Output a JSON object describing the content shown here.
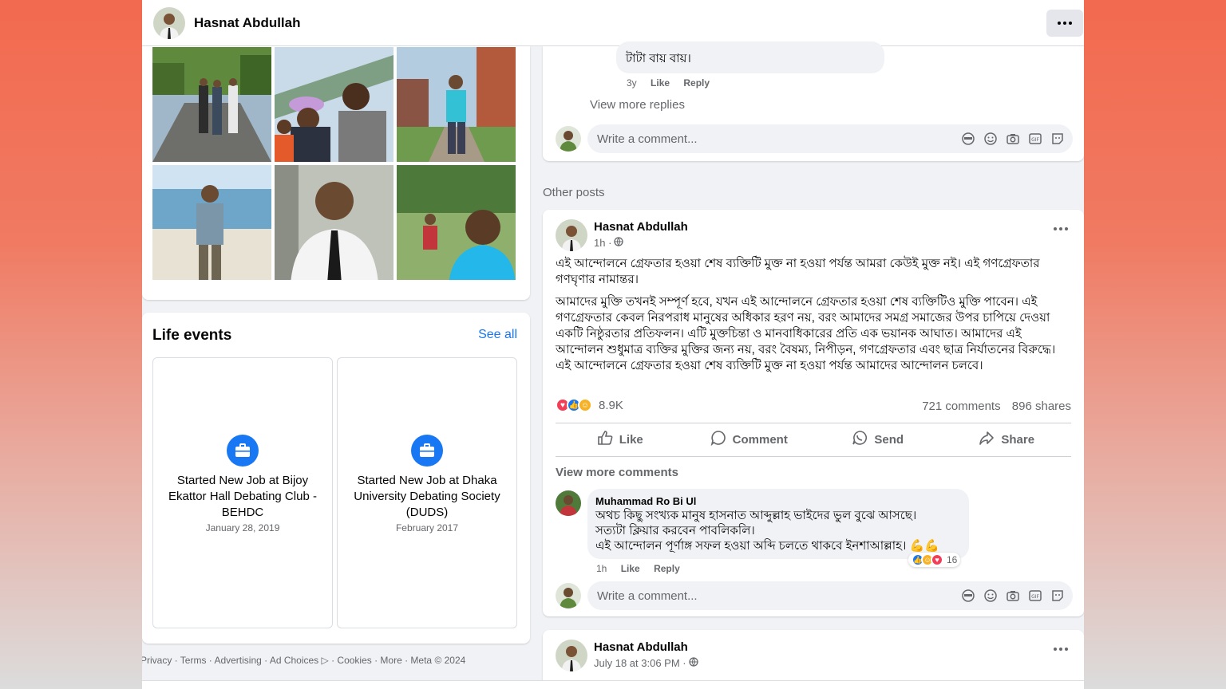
{
  "header": {
    "profile_name": "Hasnat Abdullah"
  },
  "life_events": {
    "title": "Life events",
    "see_all": "See all",
    "items": [
      {
        "title": "Started New Job at Bijoy Ekattor Hall Debating Club - BEHDC",
        "date": "January 28, 2019"
      },
      {
        "title": "Started New Job at Dhaka University Debating Society (DUDS)",
        "date": "February 2017"
      }
    ]
  },
  "footer": {
    "text": "Privacy · Terms · Advertising · Ad Choices ▷ · Cookies · More · Meta © 2024"
  },
  "prev_comments": {
    "reply_text": "টাটা বায় বায়।",
    "reply_time": "3y",
    "like": "Like",
    "reply": "Reply",
    "view_more_replies": "View more replies",
    "write_placeholder": "Write a comment..."
  },
  "other_posts_label": "Other posts",
  "post": {
    "author": "Hasnat Abdullah",
    "time": "1h ·",
    "paragraph1": "এই আন্দোলনে গ্রেফতার হওয়া শেষ ব্যক্তিটি মুক্ত না হওয়া পর্যন্ত আমরা কেউই মুক্ত নই। এই গণগ্রেফতার গণঘৃণার নামান্তর।",
    "paragraph2": "আমাদের মুক্তি তখনই সম্পূর্ণ হবে, যখন এই আন্দোলনে গ্রেফতার হওয়া শেষ ব্যক্তিটিও মুক্তি পাবেন। এই গণগ্রেফতার কেবল নিরপরাধ মানুষের অধিকার হরণ নয়, বরং আমাদের সমগ্র সমাজের উপর চাপিয়ে দেওয়া একটি নিষ্ঠুরতার প্রতিফলন। এটি মুক্তচিন্তা ও মানবাধিকারের প্রতি এক ভয়ানক আঘাত। আমাদের এই আন্দোলন শুধুমাত্র ব্যক্তির মুক্তির জন্য নয়, বরং বৈষম্য, নিপীড়ন, গণগ্রেফতার এবং ছাত্র নির্যাতনের বিরুদ্ধে। এই আন্দোলনে গ্রেফতার হওয়া শেষ ব্যক্তিটি মুক্ত না হওয়া পর্যন্ত আমাদের আন্দোলন চলবে।",
    "reaction_count": "8.9K",
    "comments_count": "721 comments",
    "shares_count": "896 shares",
    "actions": {
      "like": "Like",
      "comment": "Comment",
      "send": "Send",
      "share": "Share"
    },
    "view_more_comments": "View more comments",
    "comment": {
      "name": "Muhammad Ro Bi Ul",
      "line1": "অথচ কিছু সংখ্যক মানুষ হাসনাত আব্দুল্লাহ ভাইদের ভুল বুঝে আসছে।",
      "line2": "সত্যটা ক্লিয়ার করবেন পাবলিকলি।",
      "line3": "এই আন্দোলন পূর্ণাঙ্গ সফল হওয়া অব্দি চলতে থাকবে ইনশাআল্লাহ। 💪💪",
      "time": "1h",
      "like": "Like",
      "reply": "Reply",
      "reactions": "16"
    },
    "write_placeholder": "Write a comment..."
  },
  "post2": {
    "author": "Hasnat Abdullah",
    "time": "July 18 at 3:06 PM ·"
  },
  "colors": {
    "accent": "#1877f2",
    "love": "#f33e58",
    "care": "#f7b125"
  }
}
